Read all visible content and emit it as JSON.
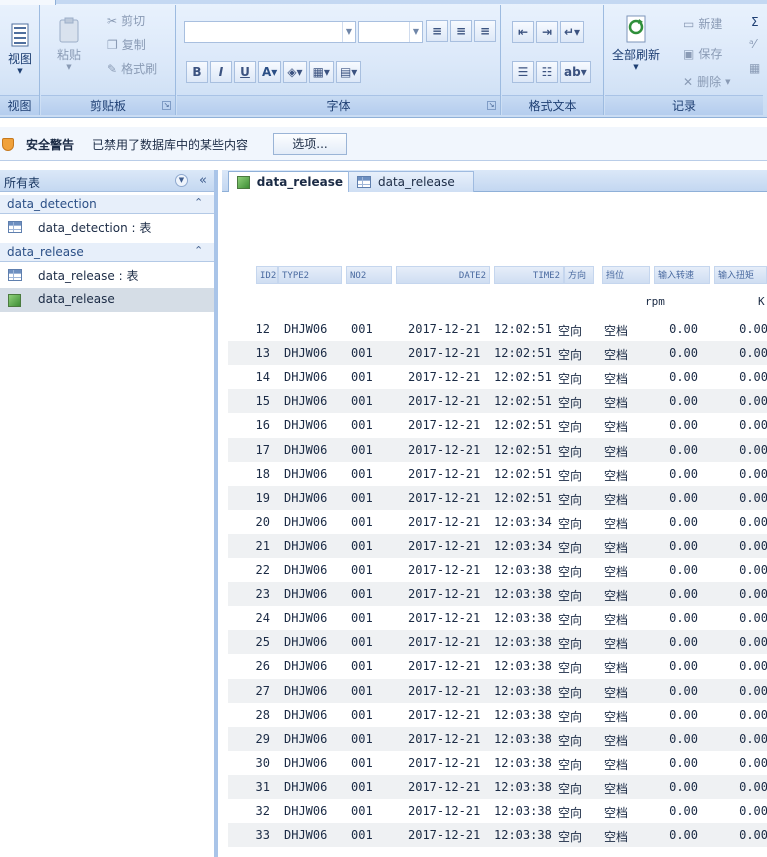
{
  "ribbon": {
    "groups": {
      "view": {
        "label": "视图",
        "view_button": "视图"
      },
      "clipboard": {
        "label": "剪贴板",
        "paste": "粘贴",
        "cut": "剪切",
        "copy": "复制",
        "format_painter": "格式刷"
      },
      "font": {
        "label": "字体",
        "bold": "B",
        "italic": "I",
        "underline": "U"
      },
      "rich_text": {
        "label": "格式文本"
      },
      "records": {
        "label": "记录",
        "refresh_all": "全部刷新",
        "new": "新建",
        "save": "保存",
        "delete": "删除"
      }
    }
  },
  "security_bar": {
    "title": "安全警告",
    "message": "已禁用了数据库中的某些内容",
    "options_button": "选项..."
  },
  "nav": {
    "header": "所有表",
    "groups": [
      {
        "label": "data_detection",
        "items": [
          {
            "label": "data_detection : 表",
            "type": "table"
          }
        ]
      },
      {
        "label": "data_release",
        "items": [
          {
            "label": "data_release : 表",
            "type": "table"
          },
          {
            "label": "data_release",
            "type": "form"
          }
        ]
      }
    ]
  },
  "tabs": [
    {
      "label": "data_release",
      "active": true,
      "icon": "form-icon"
    },
    {
      "label": "data_release",
      "active": false,
      "icon": "table-icon"
    }
  ],
  "sheet": {
    "headers": [
      "ID2",
      "TYPE2",
      "NO2",
      "DATE2",
      "TIME2",
      "方向",
      "挡位",
      "输入转速",
      "输入扭矩"
    ],
    "units": {
      "speed": "rpm",
      "torque": "K"
    },
    "rows": [
      {
        "id": "12",
        "type": "DHJW06",
        "no": "001",
        "date": "2017-12-21",
        "time": "12:02:51",
        "dir": "空向",
        "gear": "空档",
        "speed": "0.00",
        "torque": "0.00"
      },
      {
        "id": "13",
        "type": "DHJW06",
        "no": "001",
        "date": "2017-12-21",
        "time": "12:02:51",
        "dir": "空向",
        "gear": "空档",
        "speed": "0.00",
        "torque": "0.00"
      },
      {
        "id": "14",
        "type": "DHJW06",
        "no": "001",
        "date": "2017-12-21",
        "time": "12:02:51",
        "dir": "空向",
        "gear": "空档",
        "speed": "0.00",
        "torque": "0.00"
      },
      {
        "id": "15",
        "type": "DHJW06",
        "no": "001",
        "date": "2017-12-21",
        "time": "12:02:51",
        "dir": "空向",
        "gear": "空档",
        "speed": "0.00",
        "torque": "0.00"
      },
      {
        "id": "16",
        "type": "DHJW06",
        "no": "001",
        "date": "2017-12-21",
        "time": "12:02:51",
        "dir": "空向",
        "gear": "空档",
        "speed": "0.00",
        "torque": "0.00"
      },
      {
        "id": "17",
        "type": "DHJW06",
        "no": "001",
        "date": "2017-12-21",
        "time": "12:02:51",
        "dir": "空向",
        "gear": "空档",
        "speed": "0.00",
        "torque": "0.00"
      },
      {
        "id": "18",
        "type": "DHJW06",
        "no": "001",
        "date": "2017-12-21",
        "time": "12:02:51",
        "dir": "空向",
        "gear": "空档",
        "speed": "0.00",
        "torque": "0.00"
      },
      {
        "id": "19",
        "type": "DHJW06",
        "no": "001",
        "date": "2017-12-21",
        "time": "12:02:51",
        "dir": "空向",
        "gear": "空档",
        "speed": "0.00",
        "torque": "0.00"
      },
      {
        "id": "20",
        "type": "DHJW06",
        "no": "001",
        "date": "2017-12-21",
        "time": "12:03:34",
        "dir": "空向",
        "gear": "空档",
        "speed": "0.00",
        "torque": "0.00"
      },
      {
        "id": "21",
        "type": "DHJW06",
        "no": "001",
        "date": "2017-12-21",
        "time": "12:03:34",
        "dir": "空向",
        "gear": "空档",
        "speed": "0.00",
        "torque": "0.00"
      },
      {
        "id": "22",
        "type": "DHJW06",
        "no": "001",
        "date": "2017-12-21",
        "time": "12:03:38",
        "dir": "空向",
        "gear": "空档",
        "speed": "0.00",
        "torque": "0.00"
      },
      {
        "id": "23",
        "type": "DHJW06",
        "no": "001",
        "date": "2017-12-21",
        "time": "12:03:38",
        "dir": "空向",
        "gear": "空档",
        "speed": "0.00",
        "torque": "0.00"
      },
      {
        "id": "24",
        "type": "DHJW06",
        "no": "001",
        "date": "2017-12-21",
        "time": "12:03:38",
        "dir": "空向",
        "gear": "空档",
        "speed": "0.00",
        "torque": "0.00"
      },
      {
        "id": "25",
        "type": "DHJW06",
        "no": "001",
        "date": "2017-12-21",
        "time": "12:03:38",
        "dir": "空向",
        "gear": "空档",
        "speed": "0.00",
        "torque": "0.00"
      },
      {
        "id": "26",
        "type": "DHJW06",
        "no": "001",
        "date": "2017-12-21",
        "time": "12:03:38",
        "dir": "空向",
        "gear": "空档",
        "speed": "0.00",
        "torque": "0.00"
      },
      {
        "id": "27",
        "type": "DHJW06",
        "no": "001",
        "date": "2017-12-21",
        "time": "12:03:38",
        "dir": "空向",
        "gear": "空档",
        "speed": "0.00",
        "torque": "0.00"
      },
      {
        "id": "28",
        "type": "DHJW06",
        "no": "001",
        "date": "2017-12-21",
        "time": "12:03:38",
        "dir": "空向",
        "gear": "空档",
        "speed": "0.00",
        "torque": "0.00"
      },
      {
        "id": "29",
        "type": "DHJW06",
        "no": "001",
        "date": "2017-12-21",
        "time": "12:03:38",
        "dir": "空向",
        "gear": "空档",
        "speed": "0.00",
        "torque": "0.00"
      },
      {
        "id": "30",
        "type": "DHJW06",
        "no": "001",
        "date": "2017-12-21",
        "time": "12:03:38",
        "dir": "空向",
        "gear": "空档",
        "speed": "0.00",
        "torque": "0.00"
      },
      {
        "id": "31",
        "type": "DHJW06",
        "no": "001",
        "date": "2017-12-21",
        "time": "12:03:38",
        "dir": "空向",
        "gear": "空档",
        "speed": "0.00",
        "torque": "0.00"
      },
      {
        "id": "32",
        "type": "DHJW06",
        "no": "001",
        "date": "2017-12-21",
        "time": "12:03:38",
        "dir": "空向",
        "gear": "空档",
        "speed": "0.00",
        "torque": "0.00"
      },
      {
        "id": "33",
        "type": "DHJW06",
        "no": "001",
        "date": "2017-12-21",
        "time": "12:03:38",
        "dir": "空向",
        "gear": "空档",
        "speed": "0.00",
        "torque": "0.00"
      }
    ]
  },
  "colors": {
    "accent": "#c3d7f1",
    "selected_nav": "#d5dde6",
    "row_alt": "#eff1f3"
  }
}
